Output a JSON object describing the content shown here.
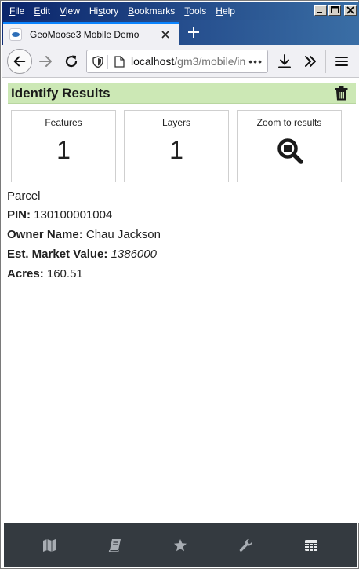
{
  "menubar": {
    "items": [
      "File",
      "Edit",
      "View",
      "History",
      "Bookmarks",
      "Tools",
      "Help"
    ],
    "mnemonics": [
      "F",
      "E",
      "V",
      "s",
      "B",
      "T",
      "H"
    ]
  },
  "tab": {
    "title": "GeoMoose3 Mobile Demo"
  },
  "navbar": {
    "url_host": "localhost",
    "url_path": "/gm3/mobile/in",
    "url_more": "•••"
  },
  "identify": {
    "title": "Identify Results",
    "stats": [
      {
        "label": "Features",
        "value": "1"
      },
      {
        "label": "Layers",
        "value": "1"
      },
      {
        "label": "Zoom to results"
      }
    ],
    "layer_name": "Parcel",
    "attributes": [
      {
        "label": "PIN:",
        "value": "130100001004"
      },
      {
        "label": "Owner Name:",
        "value": "Chau Jackson"
      },
      {
        "label": "Est. Market Value:",
        "value": "1386000"
      },
      {
        "label": "Acres:",
        "value": "160.51"
      }
    ]
  },
  "bottom_bar": {
    "icons": [
      "map-icon",
      "book-icon",
      "star-icon",
      "wrench-icon",
      "table-icon"
    ]
  },
  "colors": {
    "header_bg": "#cce8b5",
    "bottom_bar_bg": "#343a40",
    "menubar_bg": "#0a246a",
    "tab_accent": "#0a84ff"
  }
}
